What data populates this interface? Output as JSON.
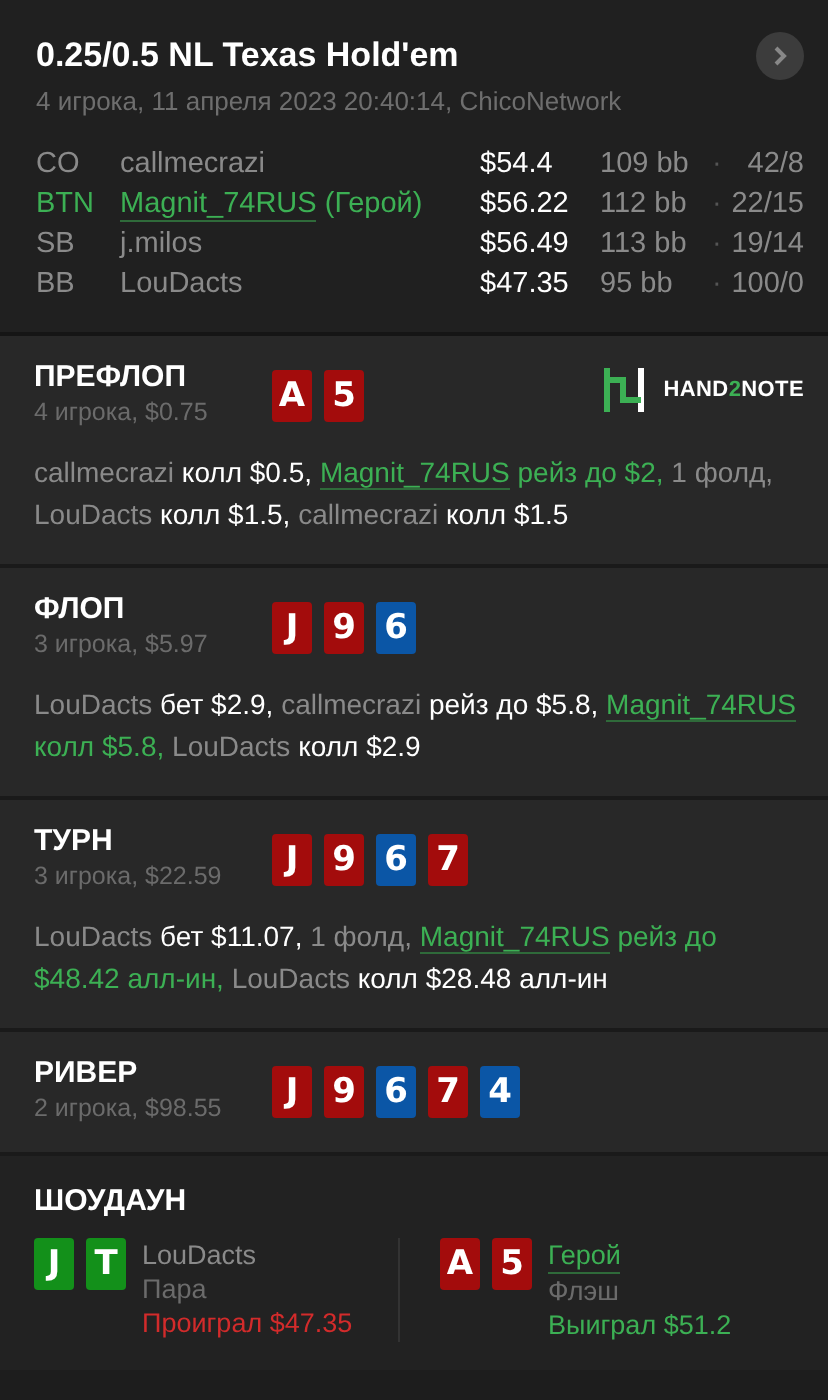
{
  "header": {
    "title": "0.25/0.5 NL Texas Hold'em",
    "subtitle": "4 игрока, 11 апреля 2023 20:40:14, ChicoNetwork",
    "players": [
      {
        "position": "CO",
        "name": "callmecrazi",
        "hero": false,
        "stack": "$54.4",
        "bb": "109 bb",
        "dot": "·",
        "stats": "42/8"
      },
      {
        "position": "BTN",
        "name": "Magnit_74RUS",
        "hero_tag": "(Герой)",
        "hero": true,
        "stack": "$56.22",
        "bb": "112 bb",
        "dot": "·",
        "stats": "22/15"
      },
      {
        "position": "SB",
        "name": "j.milos",
        "hero": false,
        "stack": "$56.49",
        "bb": "113 bb",
        "dot": "·",
        "stats": "19/14"
      },
      {
        "position": "BB",
        "name": "LouDacts",
        "hero": false,
        "stack": "$47.35",
        "bb": "95 bb",
        "dot": "·",
        "stats": "100/0"
      }
    ]
  },
  "streets": [
    {
      "name": "ПРЕФЛОП",
      "info": "4 игрока, $0.75",
      "logo": [
        {
          "text": "HAND",
          "accent": false
        },
        {
          "text": "2",
          "accent": true
        },
        {
          "text": "NOTE",
          "accent": false
        }
      ],
      "cards": [
        {
          "rank": "A",
          "color": "#a30c0c"
        },
        {
          "rank": "5",
          "color": "#a30c0c"
        }
      ],
      "actions": [
        {
          "kind": "move",
          "player": "callmecrazi",
          "text": "колл $0.5,",
          "hero": false
        },
        {
          "kind": "move",
          "player": "Magnit_74RUS",
          "text": "рейз до $2,",
          "hero": true
        },
        {
          "kind": "note",
          "text": "1 фолд,"
        },
        {
          "kind": "move",
          "player": "LouDacts",
          "text": "колл $1.5,",
          "hero": false
        },
        {
          "kind": "move",
          "player": "callmecrazi",
          "text": "колл $1.5",
          "hero": false
        }
      ]
    },
    {
      "name": "ФЛОП",
      "info": "3 игрока, $5.97",
      "cards": [
        {
          "rank": "J",
          "color": "#a30c0c"
        },
        {
          "rank": "9",
          "color": "#a30c0c"
        },
        {
          "rank": "6",
          "color": "#0b56a6"
        }
      ],
      "actions": [
        {
          "kind": "move",
          "player": "LouDacts",
          "text": "бет $2.9,",
          "hero": false
        },
        {
          "kind": "move",
          "player": "callmecrazi",
          "text": "рейз до $5.8,",
          "hero": false
        },
        {
          "kind": "move",
          "player": "Magnit_74RUS",
          "text": "колл $5.8,",
          "hero": true
        },
        {
          "kind": "move",
          "player": "LouDacts",
          "text": "колл $2.9",
          "hero": false
        }
      ]
    },
    {
      "name": "ТУРН",
      "info": "3 игрока, $22.59",
      "cards": [
        {
          "rank": "J",
          "color": "#a30c0c"
        },
        {
          "rank": "9",
          "color": "#a30c0c"
        },
        {
          "rank": "6",
          "color": "#0b56a6"
        },
        {
          "rank": "7",
          "color": "#a30c0c"
        }
      ],
      "actions": [
        {
          "kind": "move",
          "player": "LouDacts",
          "text": "бет $11.07,",
          "hero": false
        },
        {
          "kind": "note",
          "text": "1 фолд,"
        },
        {
          "kind": "move",
          "player": "Magnit_74RUS",
          "text": "рейз до $48.42 алл-ин,",
          "hero": true
        },
        {
          "kind": "move",
          "player": "LouDacts",
          "text": "колл $28.48 алл-ин",
          "hero": false
        }
      ]
    },
    {
      "name": "РИВЕР",
      "info": "2 игрока, $98.55",
      "cards": [
        {
          "rank": "J",
          "color": "#a30c0c"
        },
        {
          "rank": "9",
          "color": "#a30c0c"
        },
        {
          "rank": "6",
          "color": "#0b56a6"
        },
        {
          "rank": "7",
          "color": "#a30c0c"
        },
        {
          "rank": "4",
          "color": "#0b56a6"
        }
      ]
    }
  ],
  "showdown": {
    "title": "ШОУДАУН",
    "hands": [
      {
        "cards": [
          {
            "rank": "J",
            "color": "#13901a"
          },
          {
            "rank": "T",
            "color": "#13901a"
          }
        ],
        "player": "LouDacts",
        "hero": false,
        "combo": "Пара",
        "result": "Проиграл $47.35",
        "won": false
      },
      {
        "cards": [
          {
            "rank": "A",
            "color": "#a30c0c"
          },
          {
            "rank": "5",
            "color": "#a30c0c"
          }
        ],
        "player": "Герой",
        "hero": true,
        "combo": "Флэш",
        "result": "Выиграл $51.2",
        "won": true
      }
    ]
  }
}
